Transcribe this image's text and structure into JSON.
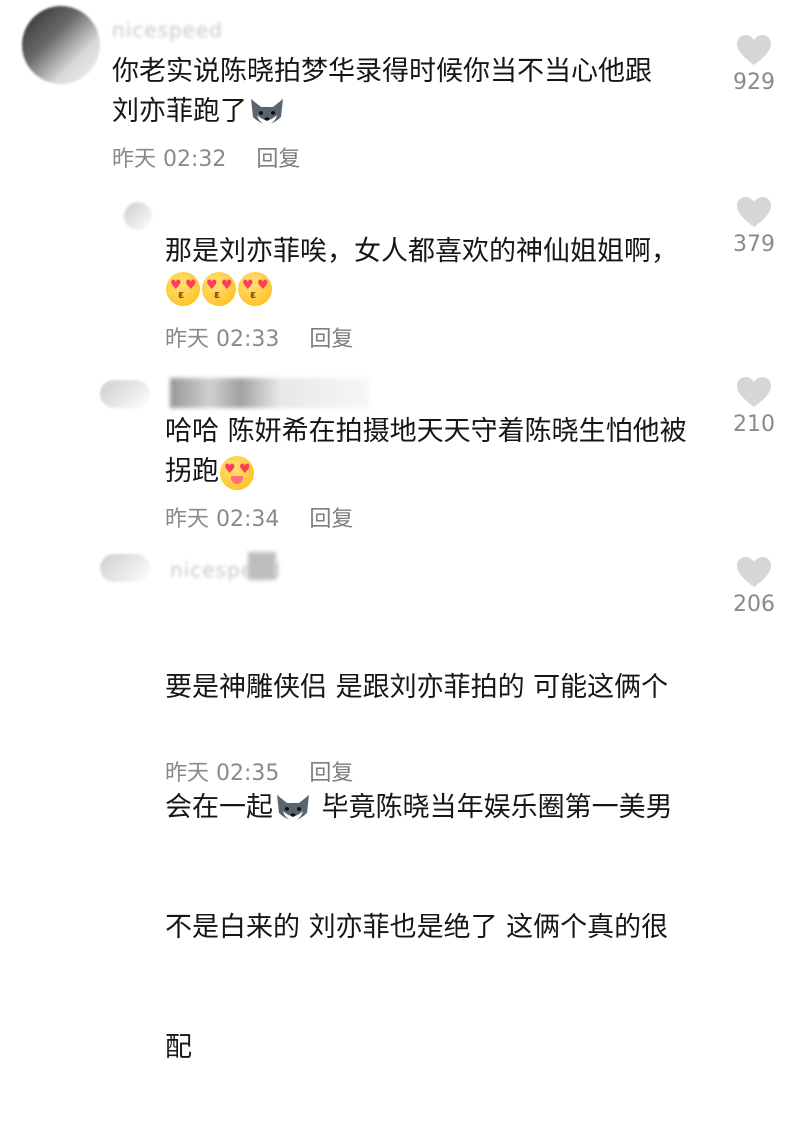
{
  "comments": [
    {
      "username": "nicespeed",
      "text": "你老实说陈晓拍梦华录得时候你当不当心他跟\n刘亦菲跑了",
      "time": "昨天 02:32",
      "reply": "回复",
      "likes": "929",
      "emojis": [
        "dog-emoji"
      ]
    },
    {
      "username": "",
      "text": "那是刘亦菲唉，女人都喜欢的神仙姐姐啊，",
      "time": "昨天 02:33",
      "reply": "回复",
      "likes": "379",
      "emojis": [
        "heart-eyes-kiss-emoji",
        "heart-eyes-kiss-emoji",
        "heart-eyes-kiss-emoji"
      ]
    },
    {
      "username": "",
      "text": "哈哈 陈妍希在拍摄地天天守着陈晓生怕他被\n拐跑",
      "time": "昨天 02:34",
      "reply": "回复",
      "likes": "210",
      "emojis": [
        "heart-eyes-tongue-emoji"
      ]
    },
    {
      "username": "nicespeed",
      "text_line1": "要是神雕侠侣 是跟刘亦菲拍的 可能这俩个",
      "text_line2a": "会在一起",
      "text_line2b": " 毕竟陈晓当年娱乐圈第一美男",
      "text_line3": "不是白来的 刘亦菲也是绝了 这俩个真的很",
      "text_line4": "配",
      "time": "昨天 02:35",
      "reply": "回复",
      "likes": "206",
      "emojis": [
        "dog-emoji"
      ]
    }
  ],
  "colors": {
    "text": "#161616",
    "meta": "#8a8a8a",
    "heart": "#d6d6d6"
  }
}
